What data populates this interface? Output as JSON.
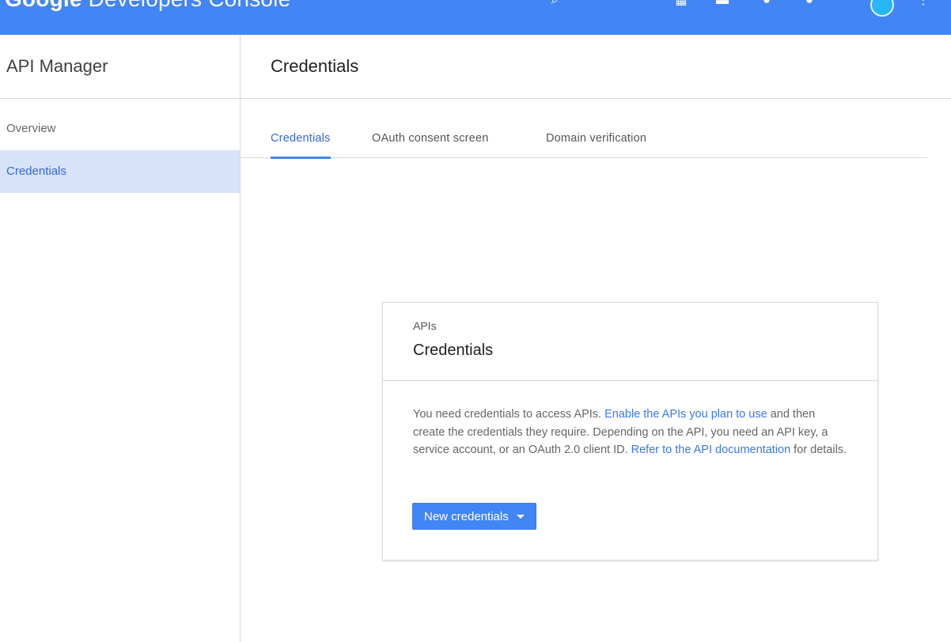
{
  "topbar": {
    "brand_google": "Google",
    "brand_rest": " Developers Console",
    "color": "#4285f4",
    "icons": [
      "search-icon",
      "apps-icon",
      "notifications-icon",
      "chat-icon",
      "help-icon",
      "avatar",
      "more-icon"
    ]
  },
  "sidebar": {
    "title": "API Manager",
    "items": [
      {
        "label": "Overview",
        "active": false
      },
      {
        "label": "Credentials",
        "active": true
      }
    ]
  },
  "main": {
    "title": "Credentials",
    "tabs": [
      {
        "label": "Credentials",
        "active": true
      },
      {
        "label": "OAuth consent screen",
        "active": false
      },
      {
        "label": "Domain verification",
        "active": false
      }
    ]
  },
  "card": {
    "subtitle": "APIs",
    "title": "Credentials",
    "text_1": "You need credentials to access APIs. ",
    "link_1": "Enable the APIs you plan to use",
    "text_2": " and then create the credentials they require. Depending on the API, you need an API key, a service account, or an OAuth 2.0 client ID. ",
    "link_2": "Refer to the API documentation",
    "text_3": " for details.",
    "button_label": "New credentials"
  },
  "colors": {
    "accent": "#4285f4",
    "link": "#3b78e7",
    "active_nav_bg": "#d7e3f8"
  }
}
